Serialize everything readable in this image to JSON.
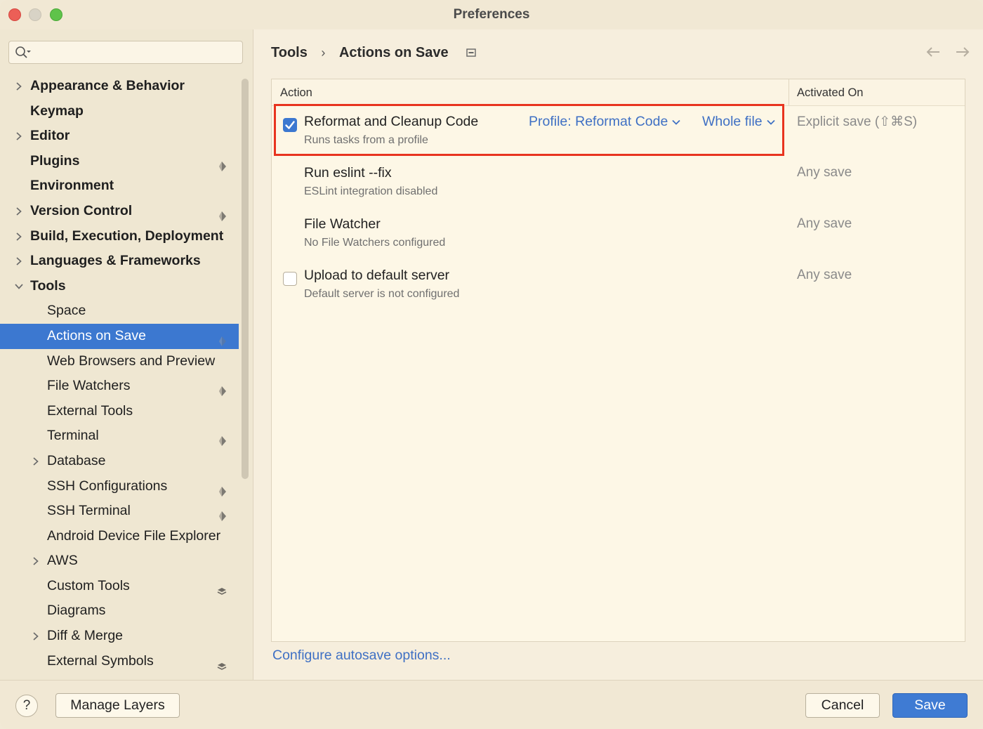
{
  "window": {
    "title": "Preferences"
  },
  "search": {
    "placeholder": ""
  },
  "sidebar": {
    "items": [
      {
        "label": "Appearance & Behavior",
        "level": 0,
        "bold": true,
        "expandable": true,
        "expanded": false,
        "layer_icon": "",
        "selected": false
      },
      {
        "label": "Keymap",
        "level": 0,
        "bold": true,
        "expandable": false,
        "layer_icon": "",
        "selected": false
      },
      {
        "label": "Editor",
        "level": 0,
        "bold": true,
        "expandable": true,
        "expanded": false,
        "layer_icon": "",
        "selected": false
      },
      {
        "label": "Plugins",
        "level": 0,
        "bold": true,
        "expandable": false,
        "layer_icon": "project-layer-icon",
        "selected": false
      },
      {
        "label": "Environment",
        "level": 0,
        "bold": true,
        "expandable": false,
        "layer_icon": "",
        "selected": false
      },
      {
        "label": "Version Control",
        "level": 0,
        "bold": true,
        "expandable": true,
        "expanded": false,
        "layer_icon": "project-layer-icon",
        "selected": false
      },
      {
        "label": "Build, Execution, Deployment",
        "level": 0,
        "bold": true,
        "expandable": true,
        "expanded": false,
        "layer_icon": "",
        "selected": false
      },
      {
        "label": "Languages & Frameworks",
        "level": 0,
        "bold": true,
        "expandable": true,
        "expanded": false,
        "layer_icon": "",
        "selected": false
      },
      {
        "label": "Tools",
        "level": 0,
        "bold": true,
        "expandable": true,
        "expanded": true,
        "layer_icon": "",
        "selected": false
      },
      {
        "label": "Space",
        "level": 1,
        "bold": false,
        "expandable": false,
        "layer_icon": "",
        "selected": false
      },
      {
        "label": "Actions on Save",
        "level": 1,
        "bold": false,
        "expandable": false,
        "layer_icon": "project-layer-icon",
        "selected": true
      },
      {
        "label": "Web Browsers and Preview",
        "level": 1,
        "bold": false,
        "expandable": false,
        "layer_icon": "",
        "selected": false
      },
      {
        "label": "File Watchers",
        "level": 1,
        "bold": false,
        "expandable": false,
        "layer_icon": "project-layer-icon",
        "selected": false
      },
      {
        "label": "External Tools",
        "level": 1,
        "bold": false,
        "expandable": false,
        "layer_icon": "",
        "selected": false
      },
      {
        "label": "Terminal",
        "level": 1,
        "bold": false,
        "expandable": false,
        "layer_icon": "project-layer-icon",
        "selected": false
      },
      {
        "label": "Database",
        "level": 1,
        "bold": false,
        "expandable": true,
        "expanded": false,
        "layer_icon": "",
        "selected": false
      },
      {
        "label": "SSH Configurations",
        "level": 1,
        "bold": false,
        "expandable": false,
        "layer_icon": "project-layer-icon",
        "selected": false
      },
      {
        "label": "SSH Terminal",
        "level": 1,
        "bold": false,
        "expandable": false,
        "layer_icon": "project-layer-icon",
        "selected": false
      },
      {
        "label": "Android Device File Explorer",
        "level": 1,
        "bold": false,
        "expandable": false,
        "layer_icon": "",
        "selected": false
      },
      {
        "label": "AWS",
        "level": 1,
        "bold": false,
        "expandable": true,
        "expanded": false,
        "layer_icon": "",
        "selected": false
      },
      {
        "label": "Custom Tools",
        "level": 1,
        "bold": false,
        "expandable": false,
        "layer_icon": "stack-layers-icon",
        "selected": false
      },
      {
        "label": "Diagrams",
        "level": 1,
        "bold": false,
        "expandable": false,
        "layer_icon": "",
        "selected": false
      },
      {
        "label": "Diff & Merge",
        "level": 1,
        "bold": false,
        "expandable": true,
        "expanded": false,
        "layer_icon": "",
        "selected": false
      },
      {
        "label": "External Symbols",
        "level": 1,
        "bold": false,
        "expandable": false,
        "layer_icon": "stack-layers-icon",
        "selected": false
      }
    ]
  },
  "breadcrumb": {
    "parent": "Tools",
    "separator": "›",
    "current": "Actions on Save"
  },
  "table": {
    "header": {
      "action": "Action",
      "activated_on": "Activated On"
    },
    "rows": [
      {
        "checkbox": "checked",
        "title": "Reformat and Cleanup Code",
        "subtitle": "Runs tasks from a profile",
        "profile_link": "Profile: Reformat Code",
        "scope_link": "Whole file",
        "activated_on": "Explicit save (⇧⌘S)",
        "highlighted": true
      },
      {
        "checkbox": "none",
        "title": "Run eslint --fix",
        "subtitle": "ESLint integration disabled",
        "activated_on": "Any save"
      },
      {
        "checkbox": "none",
        "title": "File Watcher",
        "subtitle": "No File Watchers configured",
        "activated_on": "Any save"
      },
      {
        "checkbox": "unchecked",
        "title": "Upload to default server",
        "subtitle": "Default server is not configured",
        "activated_on": "Any save"
      }
    ]
  },
  "links": {
    "autosave": "Configure autosave options..."
  },
  "footer": {
    "help": "?",
    "manage_layers": "Manage Layers",
    "cancel": "Cancel",
    "save": "Save"
  },
  "colors": {
    "accent": "#3c78d0",
    "link": "#3f70c4",
    "highlight": "#e8341f",
    "background": "#f6eedd"
  }
}
